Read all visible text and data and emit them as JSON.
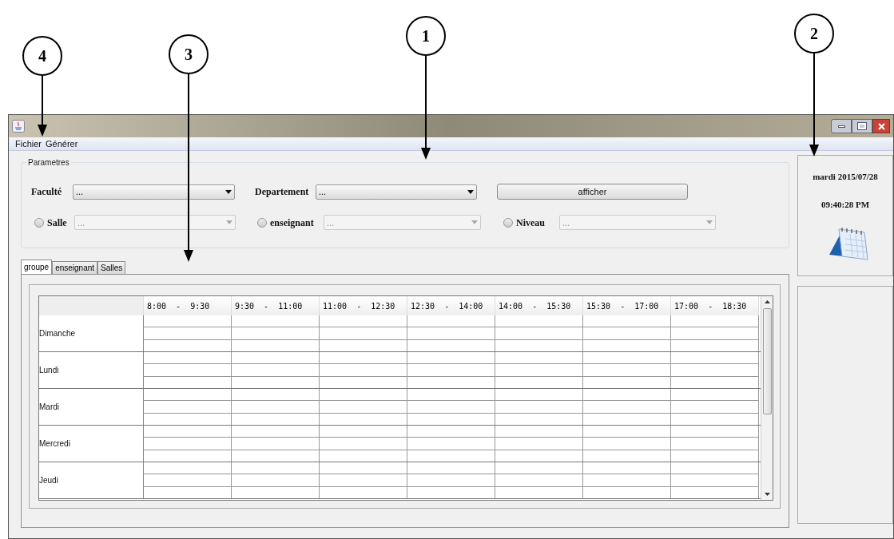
{
  "annotations": [
    {
      "label": "1"
    },
    {
      "label": "2"
    },
    {
      "label": "3"
    },
    {
      "label": "4"
    }
  ],
  "menu": [
    "Fichier",
    "Générer"
  ],
  "parametres": {
    "title": "Parametres",
    "selects": [
      {
        "label": "Faculté",
        "value": "...",
        "disabled": false
      },
      {
        "label": "Departement",
        "value": "...",
        "disabled": false
      },
      {
        "label": "Salle",
        "value": "...",
        "checked": false,
        "disabled": true
      },
      {
        "label": "enseignant",
        "value": "...",
        "checked": false,
        "disabled": true
      },
      {
        "label": "Niveau",
        "value": "...",
        "checked": false,
        "disabled": true
      }
    ],
    "button": "afficher"
  },
  "tabs": [
    {
      "label": "groupe",
      "selected": true
    },
    {
      "label": "enseignant",
      "selected": false
    },
    {
      "label": "Salles",
      "selected": false
    }
  ],
  "table": {
    "columns": [
      "8:00  -  9:30",
      "9:30  -  11:00",
      "11:00  -  12:30",
      "12:30  -  14:00",
      "14:00  -  15:30",
      "15:30  -  17:00",
      "17:00  -  18:30"
    ],
    "rows": [
      "Dimanche",
      "Lundi",
      "Mardi",
      "Mercredi",
      "Jeudi"
    ]
  },
  "clock": {
    "date": "mardi 2015/07/28",
    "time": "09:40:28 PM"
  }
}
